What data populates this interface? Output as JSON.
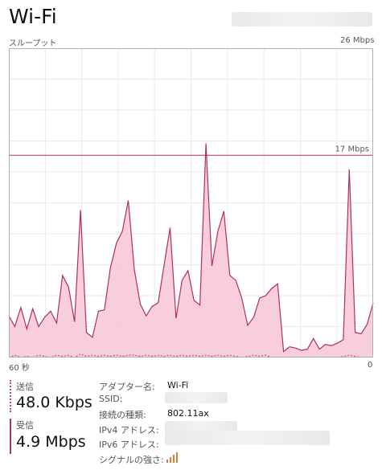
{
  "header": {
    "title": "Wi-Fi"
  },
  "chart": {
    "left_caption": "スループット",
    "max_label": "26 Mbps",
    "time_label": "60 秒",
    "min_label": "0",
    "marker_label": "17 Mbps",
    "fill_color": "#f7c6d3",
    "line_color": "#b0305e"
  },
  "chart_data": {
    "type": "area",
    "title": "",
    "xlabel": "",
    "ylabel": "スループット",
    "xlim": [
      60,
      0
    ],
    "ylim": [
      0,
      26
    ],
    "grid": true,
    "reference_line": 17,
    "series": [
      {
        "values": [
          3.5,
          2.6,
          4.2,
          2.4,
          4.1,
          2.6,
          3.4,
          3.9,
          2.9,
          6.9,
          5.9,
          3.0,
          12.4,
          2.1,
          1.7,
          3.9,
          4.0,
          7.5,
          9.6,
          10.6,
          13.2,
          7.4,
          4.5,
          3.5,
          4.3,
          4.6,
          7.8,
          10.9,
          3.3,
          6.5,
          7.3,
          4.8,
          4.4,
          18.0,
          7.7,
          10.6,
          12.3,
          6.9,
          6.5,
          5.0,
          2.7,
          3.4,
          5.0,
          5.2,
          5.8,
          6.2,
          0.5,
          0.9,
          0.8,
          0.6,
          0.7,
          1.6,
          0.7,
          1.1,
          1.0,
          1.2,
          1.5,
          15.8,
          2.1,
          2.0,
          2.8,
          4.6
        ]
      },
      {
        "values": [
          0,
          0.2,
          0,
          0.1,
          0,
          0.2,
          0.1,
          0,
          0.2,
          0.1,
          0.2,
          0,
          0.3,
          0.1,
          0.2,
          0.1,
          0.2,
          0.1,
          0.2,
          0.1,
          0.2,
          0.2,
          0.1,
          0.2,
          0.1,
          0.2,
          0.1,
          0.2,
          0.1,
          0.2,
          0.1,
          0.2,
          0.1,
          0.2,
          0.1,
          0.2,
          0.1,
          0.2,
          0.1,
          0,
          0.1,
          0.2,
          0.1,
          0.2,
          0,
          0,
          0,
          0,
          0,
          0,
          0,
          0,
          0,
          0,
          0,
          0,
          0.1,
          0.2,
          0.1,
          0,
          0,
          0
        ]
      }
    ]
  },
  "stats": {
    "send_label": "送信",
    "send_value": "48.0 Kbps",
    "recv_label": "受信",
    "recv_value": "4.9 Mbps",
    "send_color": "#c0407a",
    "recv_color": "#b0305e"
  },
  "details": {
    "adapter_label": "アダプター名:",
    "adapter_value": "Wi-Fi",
    "ssid_label": "SSID:",
    "conn_label": "接続の種類:",
    "conn_value": "802.11ax",
    "ipv4_label": "IPv4 アドレス:",
    "ipv6_label": "IPv6 アドレス:",
    "signal_label": "シグナルの強さ:",
    "signal_icon": "signal-strength-icon",
    "signal_color": "#e07a2e"
  }
}
